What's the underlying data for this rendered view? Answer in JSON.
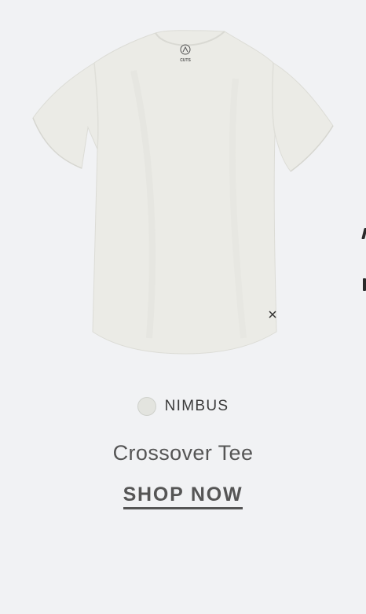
{
  "product": {
    "color_name": "NIMBUS",
    "swatch_color": "#e3e4df",
    "name": "Crossover Tee",
    "cta": "SHOP NOW",
    "image_icon": "t-shirt-image",
    "logo": "CUTS"
  },
  "colors": {
    "background": "#f1f2f4",
    "shirt": "#ebebe6",
    "text": "#555555"
  }
}
